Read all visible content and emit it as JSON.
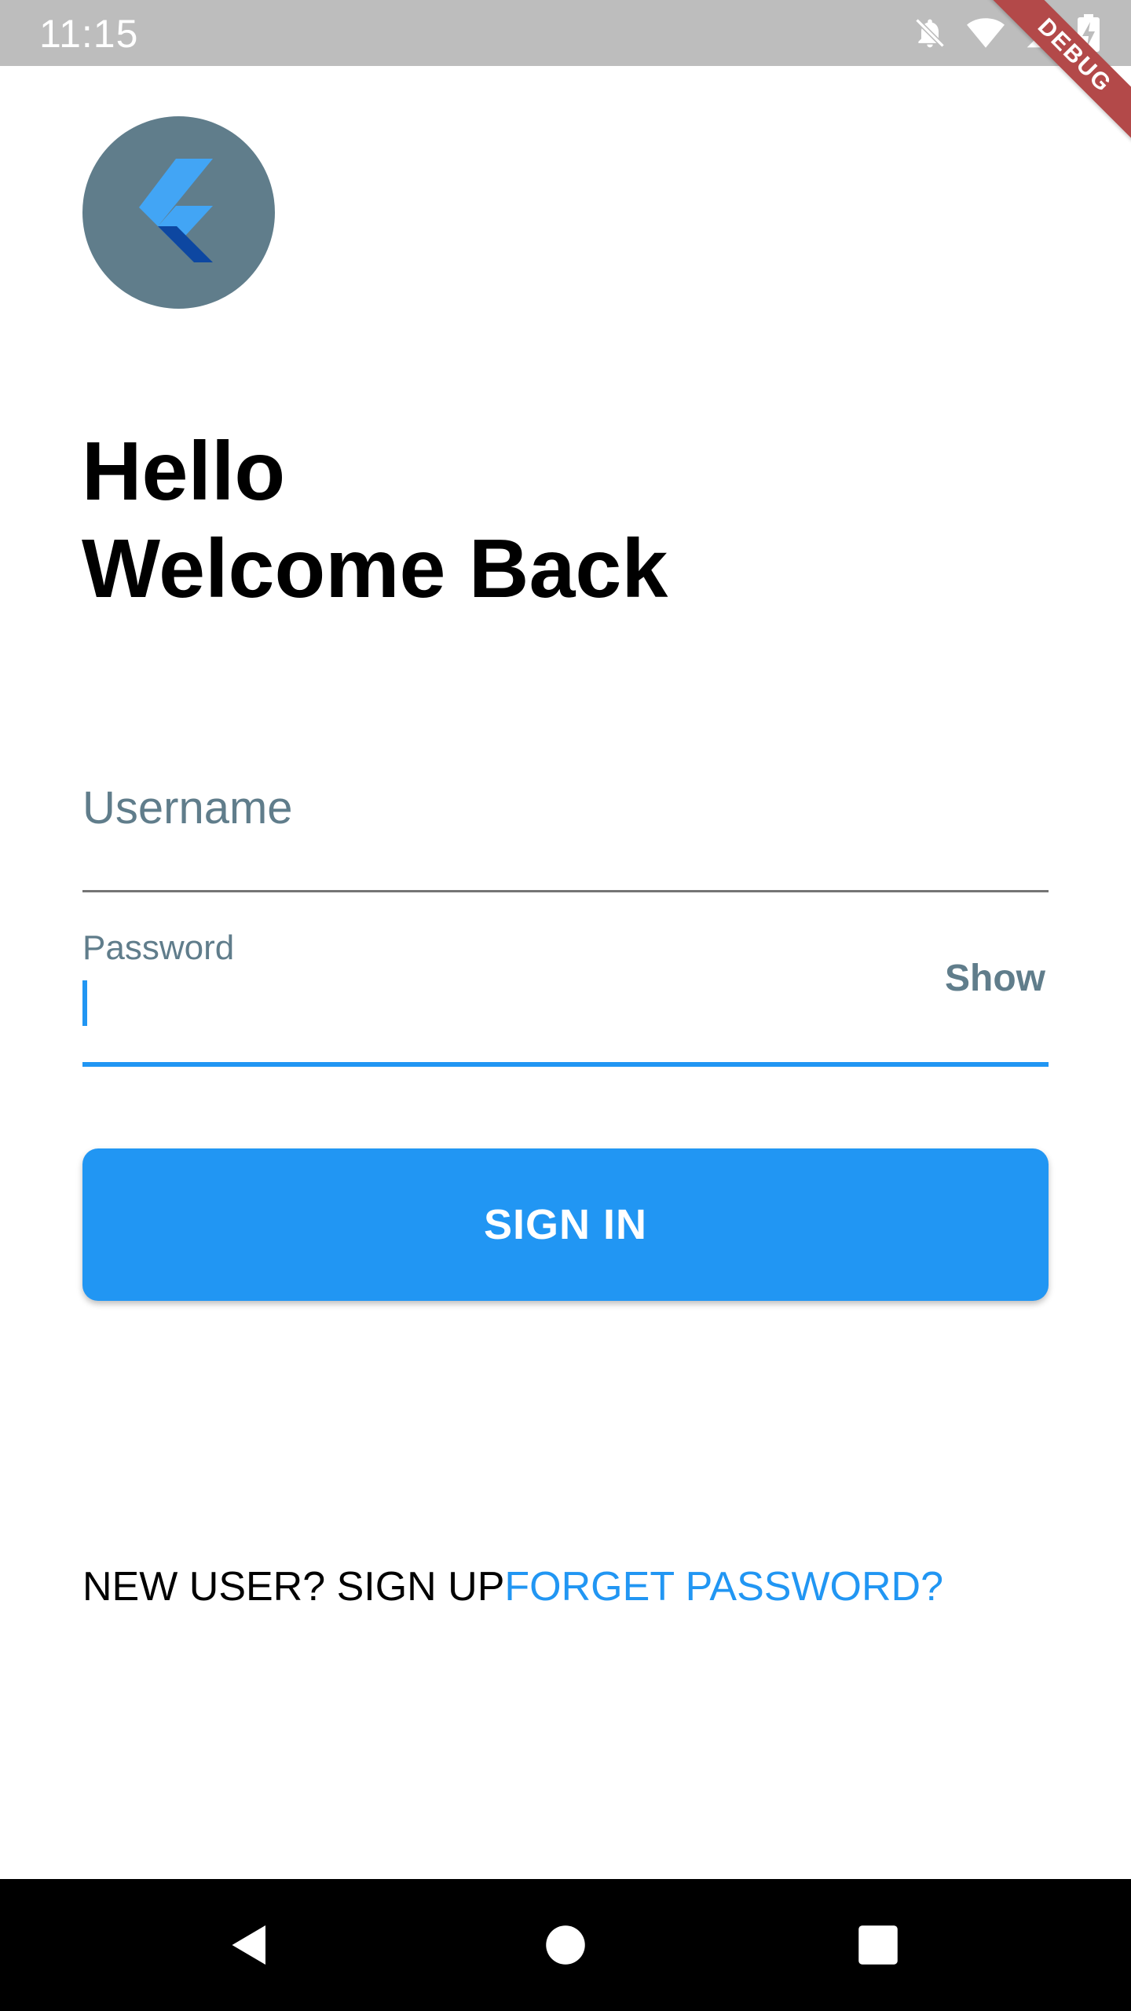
{
  "status_bar": {
    "time": "11:15",
    "icons": [
      "notifications-off-icon",
      "wifi-icon",
      "cellular-signal-icon",
      "battery-charging-icon"
    ]
  },
  "debug_banner": "DEBUG",
  "logo": {
    "icon": "flutter-logo-icon",
    "background_color": "#607d8b"
  },
  "headline": {
    "line1": "Hello",
    "line2": "Welcome Back"
  },
  "form": {
    "username": {
      "placeholder": "Username",
      "value": ""
    },
    "password": {
      "label": "Password",
      "value": "",
      "show_label": "Show"
    },
    "sign_in_label": "SIGN IN"
  },
  "links": {
    "signup": "NEW USER? SIGN UP",
    "forgot": "FORGET PASSWORD?"
  },
  "nav_bar": {
    "icons": [
      "back-icon",
      "home-icon",
      "recents-icon"
    ]
  },
  "colors": {
    "accent": "#2196f3",
    "secondary": "#607d8b"
  }
}
